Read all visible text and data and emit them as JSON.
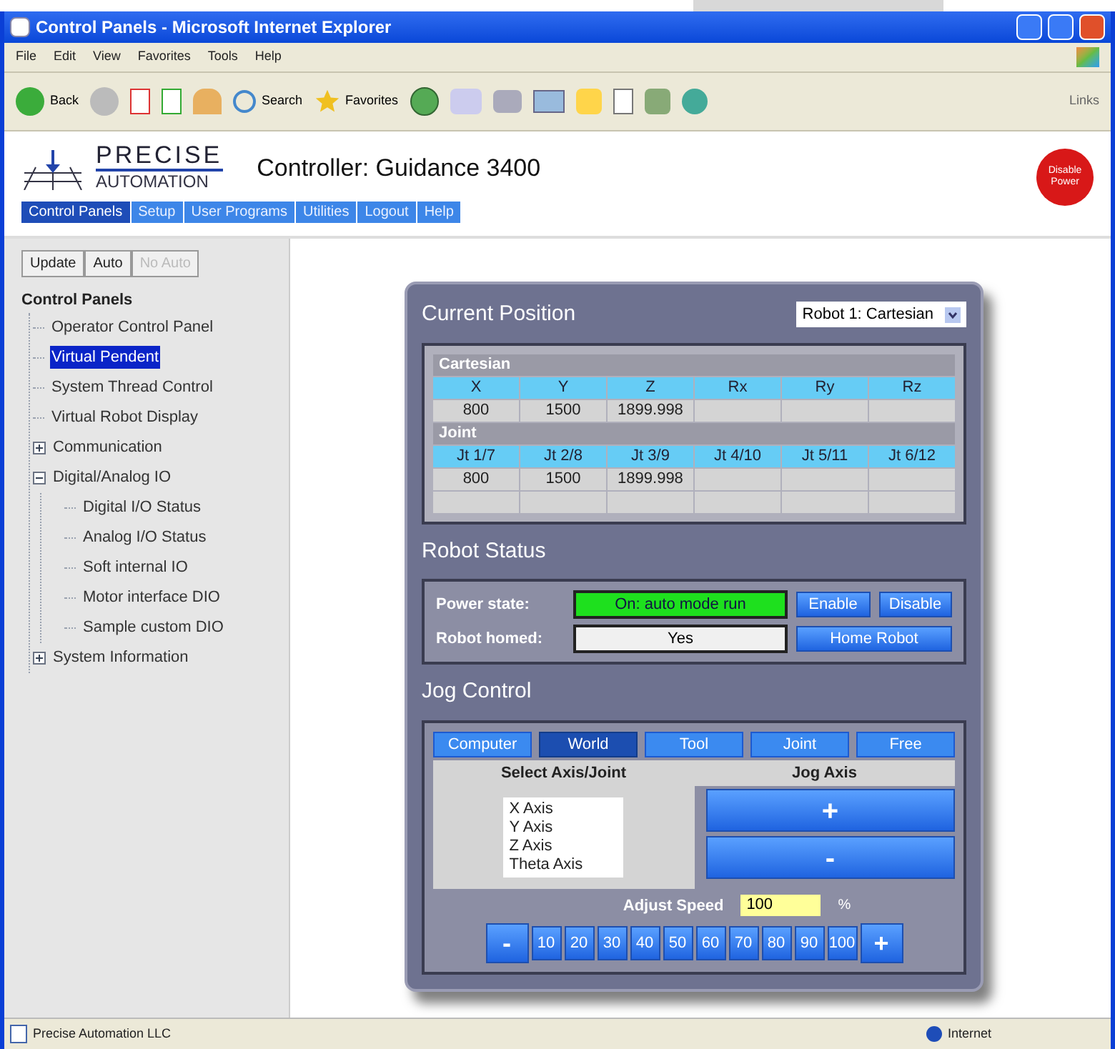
{
  "window": {
    "title": "Control Panels - Microsoft Internet Explorer"
  },
  "menu": [
    "File",
    "Edit",
    "View",
    "Favorites",
    "Tools",
    "Help"
  ],
  "toolbar": {
    "back": "Back",
    "search": "Search",
    "favorites": "Favorites",
    "links": "Links"
  },
  "header": {
    "logo_top": "PRECISE",
    "logo_bottom": "AUTOMATION",
    "title": "Controller: Guidance 3400",
    "disable_power": "Disable Power",
    "nav": [
      {
        "label": "Control Panels",
        "selected": true
      },
      {
        "label": "Setup",
        "selected": false
      },
      {
        "label": "User Programs",
        "selected": false
      },
      {
        "label": "Utilities",
        "selected": false
      },
      {
        "label": "Logout",
        "selected": false
      },
      {
        "label": "Help",
        "selected": false
      }
    ]
  },
  "sidebar": {
    "buttons": [
      {
        "label": "Update",
        "disabled": false
      },
      {
        "label": "Auto",
        "disabled": false
      },
      {
        "label": "No Auto",
        "disabled": true
      }
    ],
    "tree": {
      "label": "Control Panels",
      "children": [
        {
          "label": "Operator Control Panel",
          "selected": false
        },
        {
          "label": "Virtual Pendent",
          "selected": true
        },
        {
          "label": "System Thread Control",
          "selected": false
        },
        {
          "label": "Virtual Robot Display",
          "selected": false
        },
        {
          "label": "Communication",
          "selected": false,
          "expanded": false
        },
        {
          "label": "Digital/Analog IO",
          "selected": false,
          "expanded": true,
          "children": [
            {
              "label": "Digital I/O Status",
              "selected": false
            },
            {
              "label": "Analog I/O Status",
              "selected": false
            },
            {
              "label": "Soft internal IO",
              "selected": false
            },
            {
              "label": "Motor interface DIO",
              "selected": false
            },
            {
              "label": "Sample custom DIO",
              "selected": false
            }
          ]
        },
        {
          "label": "System Information",
          "selected": false,
          "expanded": false
        }
      ]
    }
  },
  "position": {
    "title": "Current Position",
    "robot_select": "Robot 1: Cartesian",
    "cartesian": {
      "label": "Cartesian",
      "columns": [
        "X",
        "Y",
        "Z",
        "Rx",
        "Ry",
        "Rz"
      ],
      "values": [
        "800",
        "1500",
        "1899.998"
      ]
    },
    "joint": {
      "label": "Joint",
      "columns": [
        "Jt 1/7",
        "Jt 2/8",
        "Jt 3/9",
        "Jt 4/10",
        "Jt 5/11",
        "Jt 6/12"
      ],
      "values": [
        "800",
        "1500",
        "1899.998"
      ]
    }
  },
  "status": {
    "title": "Robot Status",
    "power_label": "Power state:",
    "power_value": "On: auto mode run",
    "power_on": true,
    "enable": "Enable",
    "disable": "Disable",
    "homed_label": "Robot homed:",
    "homed_value": "Yes",
    "home": "Home Robot"
  },
  "jog": {
    "title": "Jog Control",
    "modes": [
      {
        "label": "Computer",
        "selected": false
      },
      {
        "label": "World",
        "selected": true
      },
      {
        "label": "Tool",
        "selected": false
      },
      {
        "label": "Joint",
        "selected": false
      },
      {
        "label": "Free",
        "selected": false
      }
    ],
    "axis_header": "Select Axis/Joint",
    "jog_header": "Jog Axis",
    "axes": [
      "X Axis",
      "Y Axis",
      "Z Axis",
      "Theta Axis"
    ],
    "plus": "+",
    "minus": "-",
    "speed_label": "Adjust Speed",
    "speed_value": "100",
    "speed_unit": "%",
    "speed_minus": "-",
    "speed_plus": "+",
    "speeds": [
      "10",
      "20",
      "30",
      "40",
      "50",
      "60",
      "70",
      "80",
      "90",
      "100"
    ]
  },
  "status_bar": {
    "text": "Precise Automation LLC",
    "zone": "Internet"
  }
}
